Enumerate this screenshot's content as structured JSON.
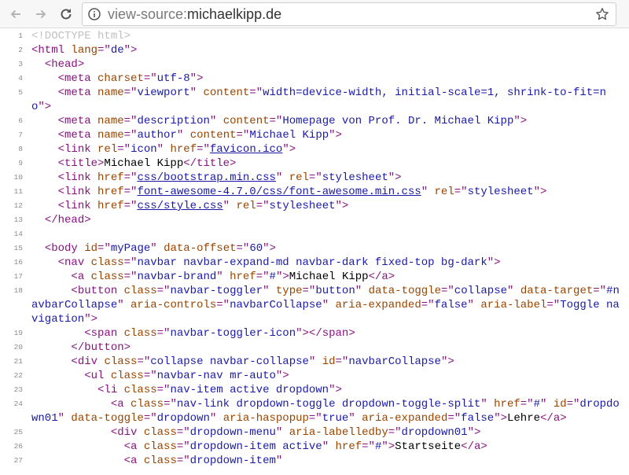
{
  "browser": {
    "url_scheme": "view-source:",
    "url_host": "michaelkipp.de",
    "icons": {
      "back": "back-arrow-icon",
      "forward": "forward-arrow-icon",
      "reload": "reload-icon",
      "info": "info-icon",
      "bookmark": "star-icon"
    }
  },
  "colors": {
    "tag": "#881280",
    "attr": "#994500",
    "value": "#1a1aa6",
    "doctype": "#c0c0c0"
  },
  "source": {
    "lines": [
      {
        "num": "1",
        "parts": [
          [
            "d",
            "<!DOCTYPE html>"
          ]
        ]
      },
      {
        "num": "2",
        "parts": [
          [
            "t",
            "<html "
          ],
          [
            "a",
            "lang"
          ],
          [
            "t",
            "=\""
          ],
          [
            "v",
            "de"
          ],
          [
            "t",
            "\">"
          ]
        ]
      },
      {
        "num": "3",
        "parts": [
          [
            "x",
            "  "
          ],
          [
            "t",
            "<head>"
          ]
        ]
      },
      {
        "num": "4",
        "parts": [
          [
            "x",
            "    "
          ],
          [
            "t",
            "<meta "
          ],
          [
            "a",
            "charset"
          ],
          [
            "t",
            "=\""
          ],
          [
            "v",
            "utf-8"
          ],
          [
            "t",
            "\">"
          ]
        ]
      },
      {
        "num": "5",
        "parts": [
          [
            "x",
            "    "
          ],
          [
            "t",
            "<meta "
          ],
          [
            "a",
            "name"
          ],
          [
            "t",
            "=\""
          ],
          [
            "v",
            "viewport"
          ],
          [
            "t",
            "\" "
          ],
          [
            "a",
            "content"
          ],
          [
            "t",
            "=\""
          ],
          [
            "v",
            "width=device-width, initial-scale=1, shrink-to-fit=no"
          ],
          [
            "t",
            "\">"
          ]
        ]
      },
      {
        "num": "6",
        "parts": [
          [
            "x",
            "    "
          ],
          [
            "t",
            "<meta "
          ],
          [
            "a",
            "name"
          ],
          [
            "t",
            "=\""
          ],
          [
            "v",
            "description"
          ],
          [
            "t",
            "\" "
          ],
          [
            "a",
            "content"
          ],
          [
            "t",
            "=\""
          ],
          [
            "v",
            "Homepage von Prof. Dr. Michael Kipp"
          ],
          [
            "t",
            "\">"
          ]
        ]
      },
      {
        "num": "7",
        "parts": [
          [
            "x",
            "    "
          ],
          [
            "t",
            "<meta "
          ],
          [
            "a",
            "name"
          ],
          [
            "t",
            "=\""
          ],
          [
            "v",
            "author"
          ],
          [
            "t",
            "\" "
          ],
          [
            "a",
            "content"
          ],
          [
            "t",
            "=\""
          ],
          [
            "v",
            "Michael Kipp"
          ],
          [
            "t",
            "\">"
          ]
        ]
      },
      {
        "num": "8",
        "parts": [
          [
            "x",
            "    "
          ],
          [
            "t",
            "<link "
          ],
          [
            "a",
            "rel"
          ],
          [
            "t",
            "=\""
          ],
          [
            "v",
            "icon"
          ],
          [
            "t",
            "\" "
          ],
          [
            "a",
            "href"
          ],
          [
            "t",
            "=\""
          ],
          [
            "l",
            "favicon.ico"
          ],
          [
            "t",
            "\">"
          ]
        ]
      },
      {
        "num": "9",
        "parts": [
          [
            "x",
            "    "
          ],
          [
            "t",
            "<title>"
          ],
          [
            "x",
            "Michael Kipp"
          ],
          [
            "t",
            "</title>"
          ]
        ]
      },
      {
        "num": "10",
        "parts": [
          [
            "x",
            "    "
          ],
          [
            "t",
            "<link "
          ],
          [
            "a",
            "href"
          ],
          [
            "t",
            "=\""
          ],
          [
            "l",
            "css/bootstrap.min.css"
          ],
          [
            "t",
            "\" "
          ],
          [
            "a",
            "rel"
          ],
          [
            "t",
            "=\""
          ],
          [
            "v",
            "stylesheet"
          ],
          [
            "t",
            "\">"
          ]
        ]
      },
      {
        "num": "11",
        "parts": [
          [
            "x",
            "    "
          ],
          [
            "t",
            "<link "
          ],
          [
            "a",
            "href"
          ],
          [
            "t",
            "=\""
          ],
          [
            "l",
            "font-awesome-4.7.0/css/font-awesome.min.css"
          ],
          [
            "t",
            "\" "
          ],
          [
            "a",
            "rel"
          ],
          [
            "t",
            "=\""
          ],
          [
            "v",
            "stylesheet"
          ],
          [
            "t",
            "\">"
          ]
        ]
      },
      {
        "num": "12",
        "parts": [
          [
            "x",
            "    "
          ],
          [
            "t",
            "<link "
          ],
          [
            "a",
            "href"
          ],
          [
            "t",
            "=\""
          ],
          [
            "l",
            "css/style.css"
          ],
          [
            "t",
            "\" "
          ],
          [
            "a",
            "rel"
          ],
          [
            "t",
            "=\""
          ],
          [
            "v",
            "stylesheet"
          ],
          [
            "t",
            "\">"
          ]
        ]
      },
      {
        "num": "13",
        "parts": [
          [
            "x",
            "  "
          ],
          [
            "t",
            "</head>"
          ]
        ]
      },
      {
        "num": "14",
        "parts": []
      },
      {
        "num": "15",
        "parts": [
          [
            "x",
            "  "
          ],
          [
            "t",
            "<body "
          ],
          [
            "a",
            "id"
          ],
          [
            "t",
            "=\""
          ],
          [
            "v",
            "myPage"
          ],
          [
            "t",
            "\" "
          ],
          [
            "a",
            "data-offset"
          ],
          [
            "t",
            "=\""
          ],
          [
            "v",
            "60"
          ],
          [
            "t",
            "\">"
          ]
        ]
      },
      {
        "num": "16",
        "parts": [
          [
            "x",
            "    "
          ],
          [
            "t",
            "<nav "
          ],
          [
            "a",
            "class"
          ],
          [
            "t",
            "=\""
          ],
          [
            "v",
            "navbar navbar-expand-md navbar-dark fixed-top bg-dark"
          ],
          [
            "t",
            "\">"
          ]
        ]
      },
      {
        "num": "17",
        "parts": [
          [
            "x",
            "      "
          ],
          [
            "t",
            "<a "
          ],
          [
            "a",
            "class"
          ],
          [
            "t",
            "=\""
          ],
          [
            "v",
            "navbar-brand"
          ],
          [
            "t",
            "\" "
          ],
          [
            "a",
            "href"
          ],
          [
            "t",
            "=\""
          ],
          [
            "v",
            "#"
          ],
          [
            "t",
            "\">"
          ],
          [
            "x",
            "Michael Kipp"
          ],
          [
            "t",
            "</a>"
          ]
        ]
      },
      {
        "num": "18",
        "parts": [
          [
            "x",
            "      "
          ],
          [
            "t",
            "<button "
          ],
          [
            "a",
            "class"
          ],
          [
            "t",
            "=\""
          ],
          [
            "v",
            "navbar-toggler"
          ],
          [
            "t",
            "\" "
          ],
          [
            "a",
            "type"
          ],
          [
            "t",
            "=\""
          ],
          [
            "v",
            "button"
          ],
          [
            "t",
            "\" "
          ],
          [
            "a",
            "data-toggle"
          ],
          [
            "t",
            "=\""
          ],
          [
            "v",
            "collapse"
          ],
          [
            "t",
            "\" "
          ],
          [
            "a",
            "data-target"
          ],
          [
            "t",
            "=\""
          ],
          [
            "v",
            "#navbarCollapse"
          ],
          [
            "t",
            "\" "
          ],
          [
            "a",
            "aria-controls"
          ],
          [
            "t",
            "=\""
          ],
          [
            "v",
            "navbarCollapse"
          ],
          [
            "t",
            "\" "
          ],
          [
            "a",
            "aria-expanded"
          ],
          [
            "t",
            "=\""
          ],
          [
            "v",
            "false"
          ],
          [
            "t",
            "\" "
          ],
          [
            "a",
            "aria-label"
          ],
          [
            "t",
            "=\""
          ],
          [
            "v",
            "Toggle navigation"
          ],
          [
            "t",
            "\">"
          ]
        ]
      },
      {
        "num": "19",
        "parts": [
          [
            "x",
            "        "
          ],
          [
            "t",
            "<span "
          ],
          [
            "a",
            "class"
          ],
          [
            "t",
            "=\""
          ],
          [
            "v",
            "navbar-toggler-icon"
          ],
          [
            "t",
            "\">"
          ],
          [
            "t",
            "</span>"
          ]
        ]
      },
      {
        "num": "20",
        "parts": [
          [
            "x",
            "      "
          ],
          [
            "t",
            "</button>"
          ]
        ]
      },
      {
        "num": "21",
        "parts": [
          [
            "x",
            "      "
          ],
          [
            "t",
            "<div "
          ],
          [
            "a",
            "class"
          ],
          [
            "t",
            "=\""
          ],
          [
            "v",
            "collapse navbar-collapse"
          ],
          [
            "t",
            "\" "
          ],
          [
            "a",
            "id"
          ],
          [
            "t",
            "=\""
          ],
          [
            "v",
            "navbarCollapse"
          ],
          [
            "t",
            "\">"
          ]
        ]
      },
      {
        "num": "22",
        "parts": [
          [
            "x",
            "        "
          ],
          [
            "t",
            "<ul "
          ],
          [
            "a",
            "class"
          ],
          [
            "t",
            "=\""
          ],
          [
            "v",
            "navbar-nav mr-auto"
          ],
          [
            "t",
            "\">"
          ]
        ]
      },
      {
        "num": "23",
        "parts": [
          [
            "x",
            "          "
          ],
          [
            "t",
            "<li "
          ],
          [
            "a",
            "class"
          ],
          [
            "t",
            "=\""
          ],
          [
            "v",
            "nav-item active dropdown"
          ],
          [
            "t",
            "\">"
          ]
        ]
      },
      {
        "num": "24",
        "parts": [
          [
            "x",
            "            "
          ],
          [
            "t",
            "<a "
          ],
          [
            "a",
            "class"
          ],
          [
            "t",
            "=\""
          ],
          [
            "v",
            "nav-link dropdown-toggle dropdown-toggle-split"
          ],
          [
            "t",
            "\" "
          ],
          [
            "a",
            "href"
          ],
          [
            "t",
            "=\""
          ],
          [
            "v",
            "#"
          ],
          [
            "t",
            "\" "
          ],
          [
            "a",
            "id"
          ],
          [
            "t",
            "=\""
          ],
          [
            "v",
            "dropdown01"
          ],
          [
            "t",
            "\" "
          ],
          [
            "a",
            "data-toggle"
          ],
          [
            "t",
            "=\""
          ],
          [
            "v",
            "dropdown"
          ],
          [
            "t",
            "\" "
          ],
          [
            "a",
            "aria-haspopup"
          ],
          [
            "t",
            "=\""
          ],
          [
            "v",
            "true"
          ],
          [
            "t",
            "\" "
          ],
          [
            "a",
            "aria-expanded"
          ],
          [
            "t",
            "=\""
          ],
          [
            "v",
            "false"
          ],
          [
            "t",
            "\">"
          ],
          [
            "x",
            "Lehre"
          ],
          [
            "t",
            "</a>"
          ]
        ]
      },
      {
        "num": "25",
        "parts": [
          [
            "x",
            "            "
          ],
          [
            "t",
            "<div "
          ],
          [
            "a",
            "class"
          ],
          [
            "t",
            "=\""
          ],
          [
            "v",
            "dropdown-menu"
          ],
          [
            "t",
            "\" "
          ],
          [
            "a",
            "aria-labelledby"
          ],
          [
            "t",
            "=\""
          ],
          [
            "v",
            "dropdown01"
          ],
          [
            "t",
            "\">"
          ]
        ]
      },
      {
        "num": "26",
        "parts": [
          [
            "x",
            "              "
          ],
          [
            "t",
            "<a "
          ],
          [
            "a",
            "class"
          ],
          [
            "t",
            "=\""
          ],
          [
            "v",
            "dropdown-item active"
          ],
          [
            "t",
            "\" "
          ],
          [
            "a",
            "href"
          ],
          [
            "t",
            "=\""
          ],
          [
            "v",
            "#"
          ],
          [
            "t",
            "\">"
          ],
          [
            "x",
            "Startseite"
          ],
          [
            "t",
            "</a>"
          ]
        ]
      },
      {
        "num": "27",
        "parts": [
          [
            "x",
            "              "
          ],
          [
            "t",
            "<a "
          ],
          [
            "a",
            "class"
          ],
          [
            "t",
            "=\""
          ],
          [
            "v",
            "dropdown-item"
          ],
          [
            "t",
            "\""
          ]
        ]
      }
    ]
  }
}
